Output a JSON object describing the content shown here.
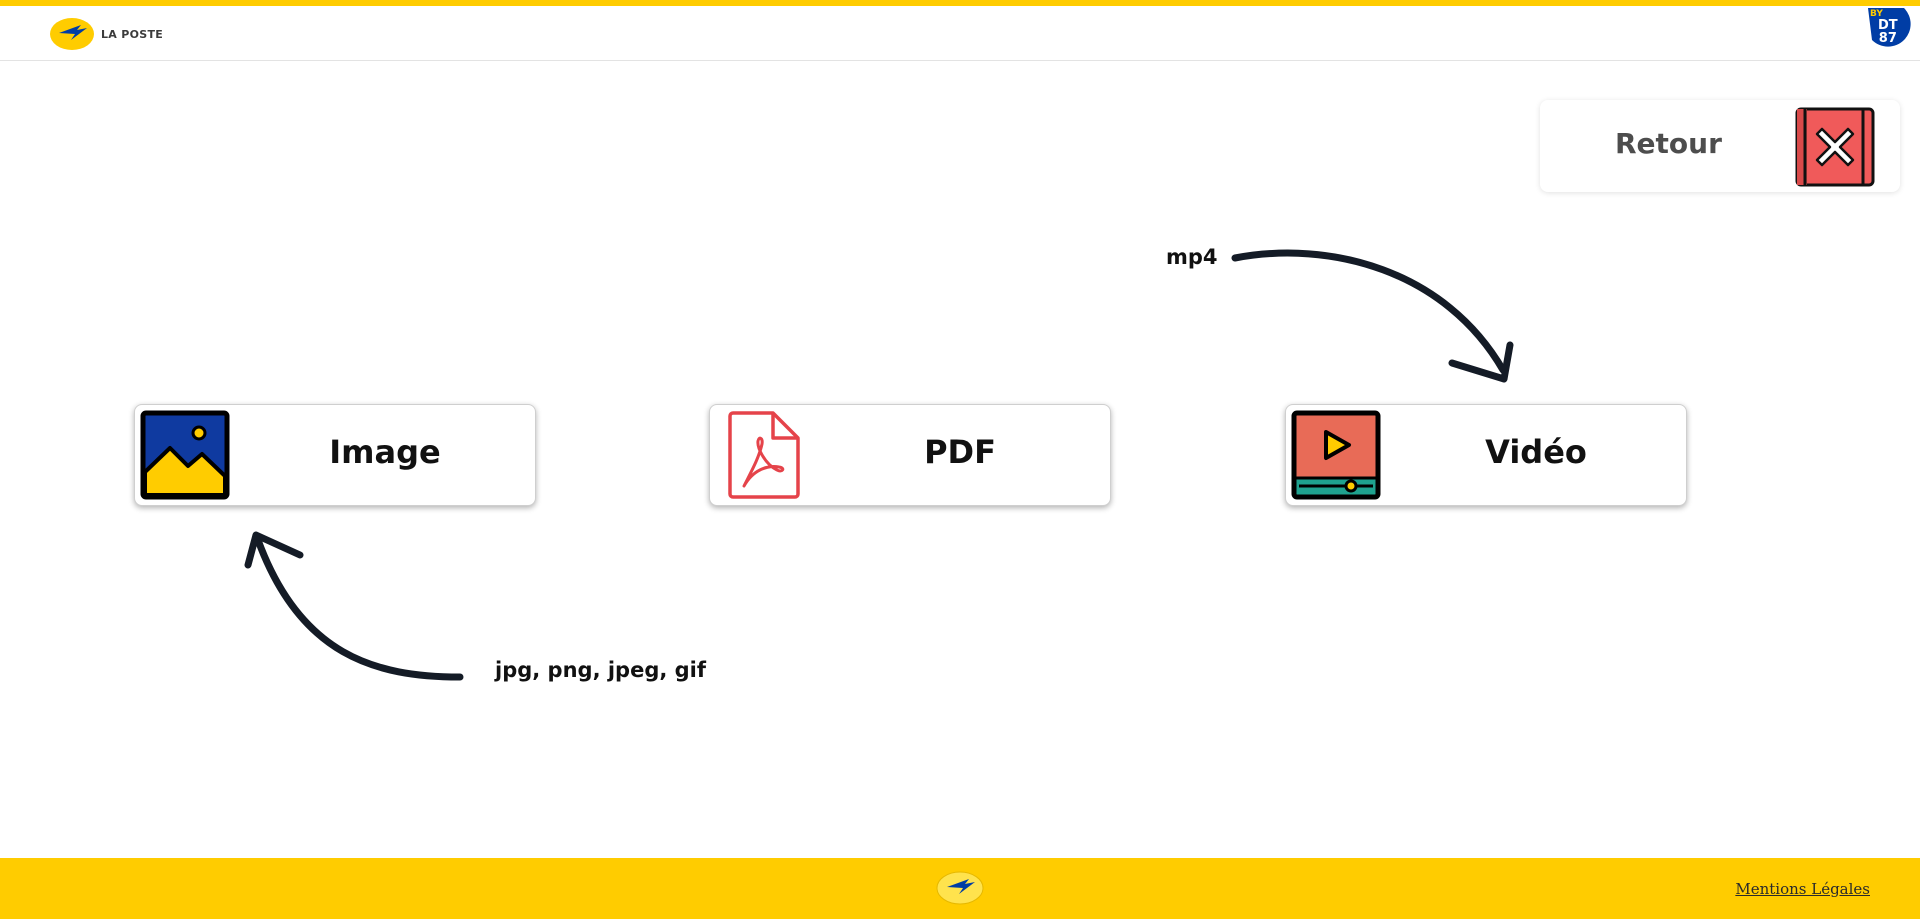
{
  "header": {
    "brand_name": "LA POSTE",
    "badge_by": "BY",
    "badge_line1": "DT",
    "badge_line2": "87",
    "icons": [
      "la-poste-logo-icon",
      "dt87-badge-icon"
    ]
  },
  "back_button": {
    "label": "Retour",
    "icon": "close-icon"
  },
  "cards": [
    {
      "label": "Image",
      "icon": "image-icon"
    },
    {
      "label": "PDF",
      "icon": "pdf-icon"
    },
    {
      "label": "Vidéo",
      "icon": "video-icon"
    }
  ],
  "hints": {
    "video_formats": "mp4",
    "image_formats": "jpg, png, jpeg, gif"
  },
  "footer": {
    "legal_link": "Mentions Légales",
    "icon": "la-poste-logo-icon"
  },
  "colors": {
    "accent_yellow": "#ffcc00",
    "brand_blue": "#003da5",
    "close_red": "#f05a5a",
    "video_orange": "#e86b57",
    "video_teal": "#1fa28f",
    "pdf_red": "#e5434a"
  }
}
